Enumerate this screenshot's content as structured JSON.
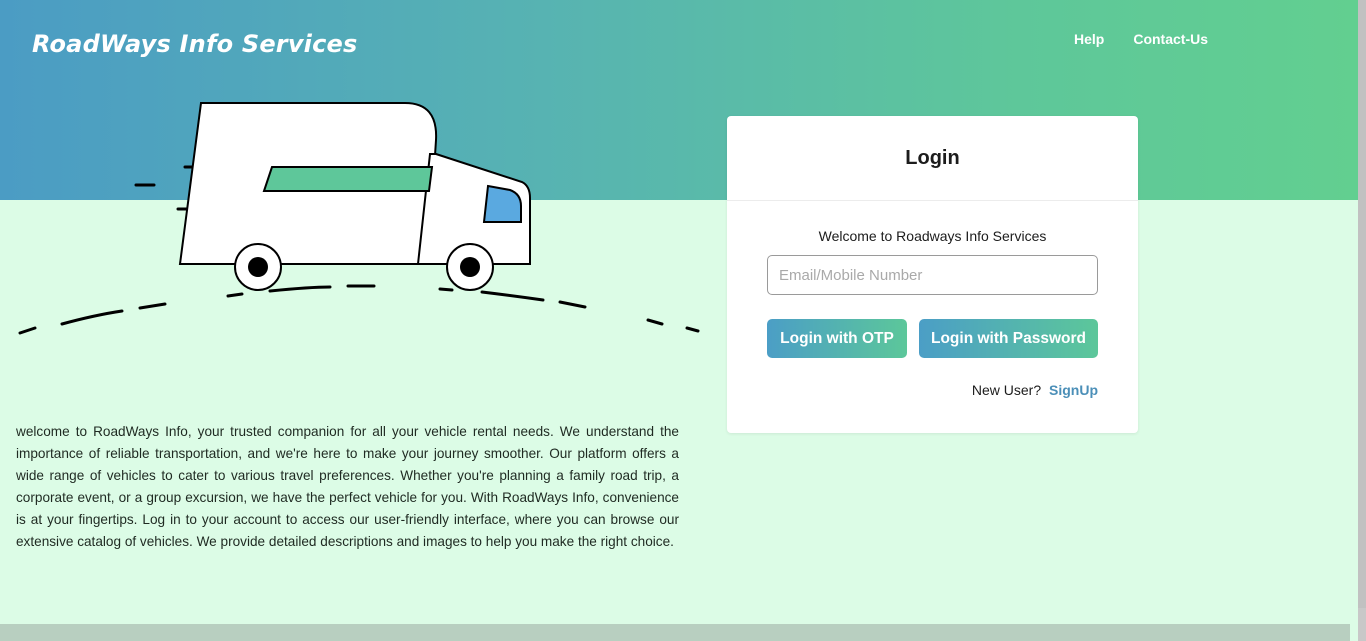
{
  "header": {
    "brand": "RoadWays Info Services",
    "nav": [
      {
        "label": "Help"
      },
      {
        "label": "Contact-Us"
      }
    ]
  },
  "about": {
    "text": "welcome to RoadWays Info, your trusted companion for all your vehicle rental needs. We understand the importance of reliable transportation, and we're here to make your journey smoother. Our platform offers a wide range of vehicles to cater to various travel preferences. Whether you're planning a family road trip, a corporate event, or a group excursion, we have the perfect vehicle for you. With RoadWays Info, convenience is at your fingertips. Log in to your account to access our user-friendly interface, where you can browse our extensive catalog of vehicles. We provide detailed descriptions and images to help you make the right choice."
  },
  "login": {
    "title": "Login",
    "welcome": "Welcome to Roadways Info Services",
    "email_placeholder": "Email/Mobile Number",
    "email_value": "",
    "otp_button": "Login with OTP",
    "password_button": "Login with Password",
    "new_user_text": "New User?",
    "signup_link": "SignUp"
  },
  "colors": {
    "gradient_start": "#4b9cc4",
    "gradient_end": "#62cf90",
    "page_background": "#dcfce6",
    "stripe_green": "#5ec79a",
    "window_blue": "#5aa9e0"
  },
  "icons": {
    "illustration": "camper-van-illustration"
  }
}
